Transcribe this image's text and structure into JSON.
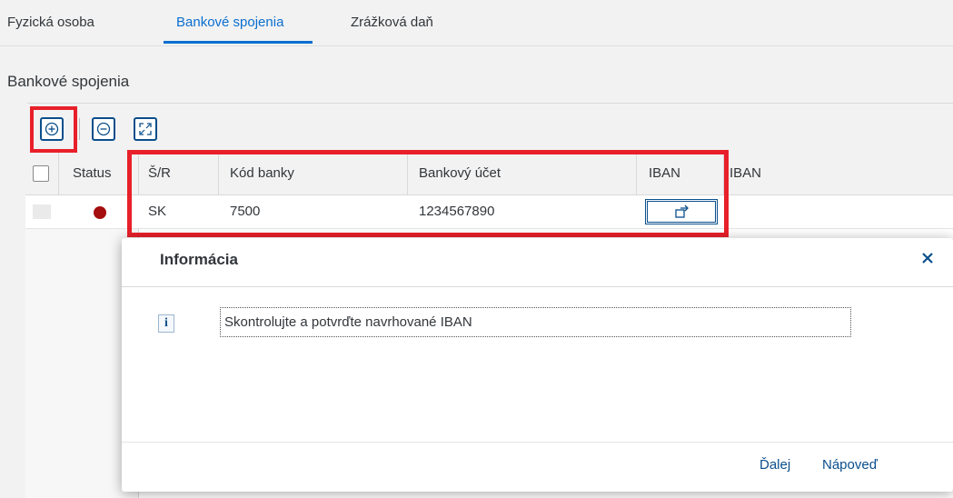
{
  "tabs": [
    {
      "label": "Fyzická osoba"
    },
    {
      "label": "Bankové spojenia"
    },
    {
      "label": "Zrážková daň"
    }
  ],
  "section": {
    "title": "Bankové spojenia"
  },
  "toolbar": {
    "add_icon": "plus-circle-icon",
    "remove_icon": "minus-circle-icon",
    "expand_icon": "fullscreen-icon"
  },
  "table": {
    "columns": [
      "Status",
      "Š/R",
      "Kód banky",
      "Bankový účet",
      "IBAN",
      "IBAN"
    ],
    "rows": [
      {
        "status_color": "#a50e0e",
        "country": "SK",
        "bank_code": "7500",
        "account": "1234567890",
        "iban_icon": "open-iban-icon"
      }
    ]
  },
  "dialog": {
    "title": "Informácia",
    "message": "Skontrolujte a potvrďte navrhované IBAN",
    "buttons": {
      "next": "Ďalej",
      "help": "Nápoveď"
    },
    "close_icon": "close-icon",
    "info_icon": "info-icon"
  },
  "colors": {
    "accent": "#0a6ed1",
    "highlight": "#e8202a"
  }
}
